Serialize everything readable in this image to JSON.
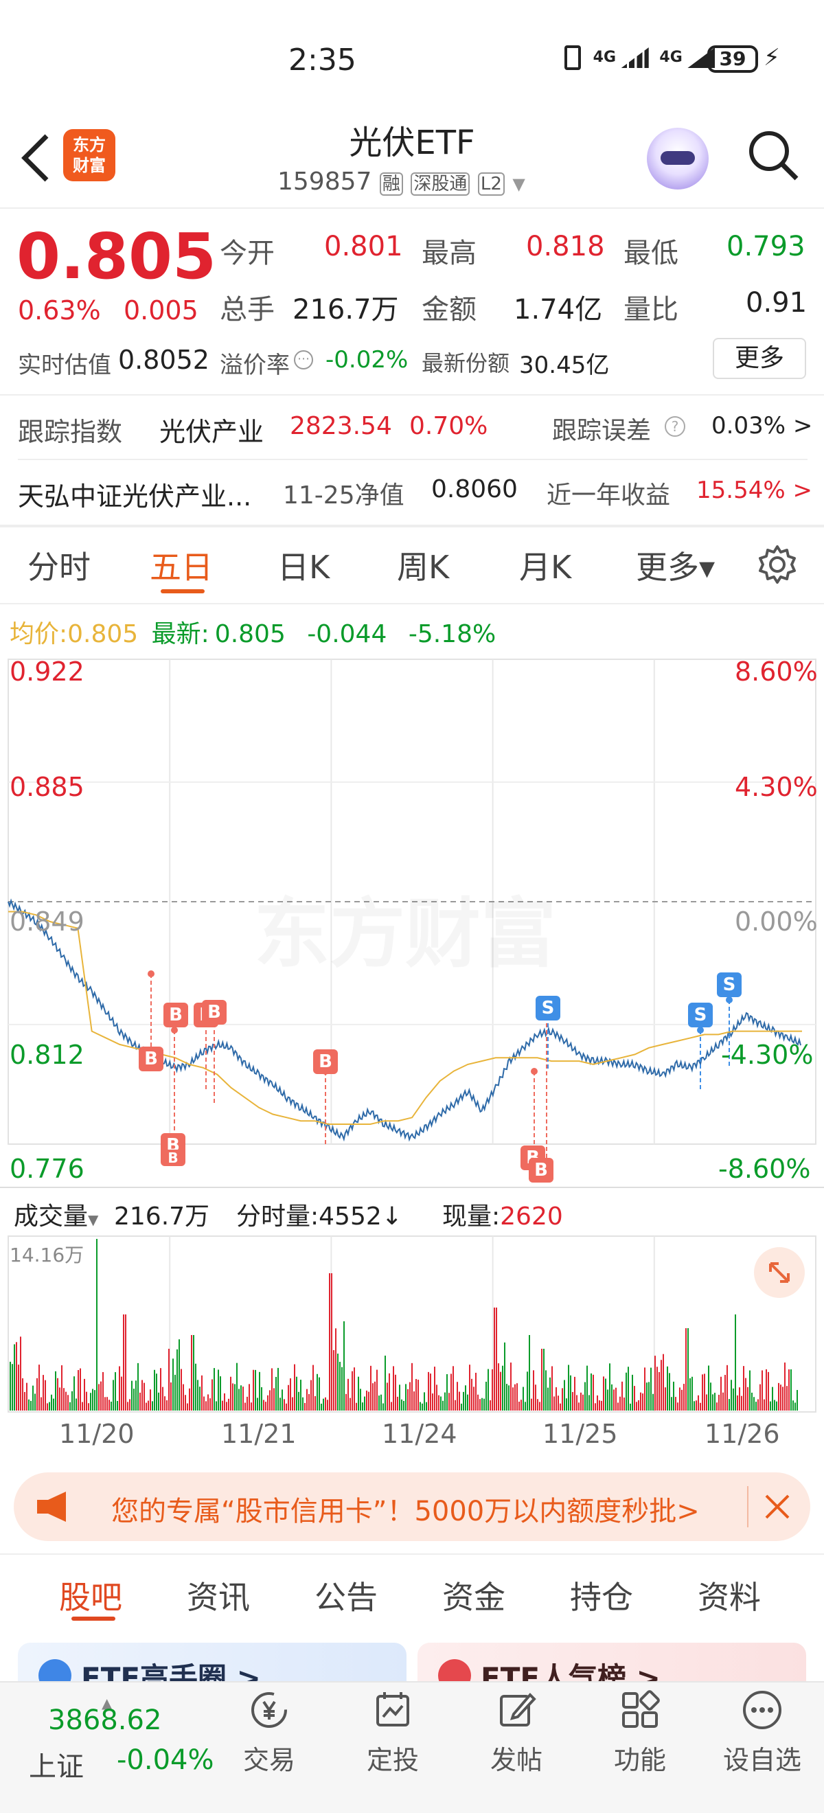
{
  "status": {
    "time": "2:35",
    "net1": "4G",
    "net2": "4G",
    "battery": "39"
  },
  "header": {
    "logo_line1": "东方",
    "logo_line2": "财富",
    "title": "光伏ETF",
    "code": "159857",
    "badge1": "融",
    "badge2": "深股通",
    "badge3": "L2"
  },
  "quote": {
    "price": "0.805",
    "pct": "0.63%",
    "chg": "0.005",
    "open_label": "今开",
    "open": "0.801",
    "high_label": "最高",
    "high": "0.818",
    "low_label": "最低",
    "low": "0.793",
    "vol_label": "总手",
    "vol": "216.7万",
    "amt_label": "金额",
    "amt": "1.74亿",
    "ratio_label": "量比",
    "ratio": "0.91",
    "iopv_label": "实时估值",
    "iopv": "0.8052",
    "premium_label": "溢价率",
    "premium": "-0.02%",
    "shares_label": "最新份额",
    "shares": "30.45亿",
    "more": "更多"
  },
  "track": {
    "label": "跟踪指数",
    "index": "光伏产业",
    "value": "2823.54",
    "pct": "0.70%",
    "err_label": "跟踪误差",
    "err": "0.03% >"
  },
  "fund": {
    "name": "天弘中证光伏产业...",
    "nav_label": "11-25净值",
    "nav": "0.8060",
    "ret_label": "近一年收益",
    "ret": "15.54% >"
  },
  "tabs": [
    "分时",
    "五日",
    "日K",
    "周K",
    "月K",
    "更多▾"
  ],
  "chart_info": {
    "avg_label": "均价:",
    "avg": "0.805",
    "last_label": "最新:",
    "last": "0.805",
    "chg": "-0.044",
    "pct": "-5.18%"
  },
  "chart_data": {
    "type": "line",
    "title": "",
    "x": [
      "11/20",
      "11/21",
      "11/24",
      "11/25",
      "11/26"
    ],
    "ylim": [
      0.776,
      0.922
    ],
    "y_ticks": [
      "0.922",
      "0.885",
      "0.849",
      "0.812",
      "0.776"
    ],
    "pct_ticks": [
      "8.60%",
      "4.30%",
      "0.00%",
      "-4.30%",
      "-8.60%"
    ],
    "series": [
      {
        "values": [
          0.849,
          0.846,
          0.843,
          0.838,
          0.832,
          0.826,
          0.822,
          0.816,
          0.81,
          0.806,
          0.803,
          0.801,
          0.799,
          0.8,
          0.804,
          0.806,
          0.805,
          0.8,
          0.797,
          0.794,
          0.79,
          0.787,
          0.784,
          0.781,
          0.778,
          0.783,
          0.786,
          0.782,
          0.78,
          0.778,
          0.781,
          0.785,
          0.788,
          0.792,
          0.786,
          0.793,
          0.801,
          0.805,
          0.809,
          0.81,
          0.807,
          0.803,
          0.801,
          0.801,
          0.8,
          0.8,
          0.798,
          0.797,
          0.8,
          0.799,
          0.802,
          0.806,
          0.81,
          0.815,
          0.812,
          0.81,
          0.808,
          0.806
        ]
      },
      {
        "values": [
          0.846,
          0.846,
          0.845,
          0.843,
          0.842,
          0.841,
          0.81,
          0.808,
          0.806,
          0.805,
          0.804,
          0.803,
          0.802,
          0.8,
          0.799,
          0.797,
          0.793,
          0.79,
          0.787,
          0.785,
          0.784,
          0.783,
          0.783,
          0.782,
          0.782,
          0.782,
          0.782,
          0.783,
          0.783,
          0.784,
          0.79,
          0.795,
          0.798,
          0.8,
          0.801,
          0.802,
          0.802,
          0.802,
          0.802,
          0.801,
          0.801,
          0.801,
          0.8,
          0.801,
          0.802,
          0.803,
          0.805,
          0.806,
          0.807,
          0.808,
          0.809,
          0.809,
          0.81,
          0.81,
          0.81,
          0.81,
          0.81,
          0.81
        ]
      }
    ],
    "trade_marks": [
      "B",
      "B",
      "B",
      "B",
      "B",
      "B",
      "B",
      "B",
      "B",
      "S",
      "S",
      "S"
    ],
    "watermark": "东方财富"
  },
  "volume": {
    "label": "成交量",
    "total": "216.7万",
    "tick_label": "分时量:",
    "tick": "4552↓",
    "now_label": "现量:",
    "now": "2620",
    "max": "14.16万"
  },
  "banner": {
    "text": "您的专属“股市信用卡”！5000万以内额度秒批>"
  },
  "bottom_tabs": [
    "股吧",
    "资讯",
    "公告",
    "资金",
    "持仓",
    "资料"
  ],
  "cards": {
    "c1": "ETF高手圈 >",
    "c2": "ETF人气榜 >"
  },
  "index": {
    "value": "3868.62",
    "name": "上证",
    "pct": "-0.04%"
  },
  "nav": [
    "交易",
    "定投",
    "发帖",
    "功能",
    "设自选"
  ]
}
